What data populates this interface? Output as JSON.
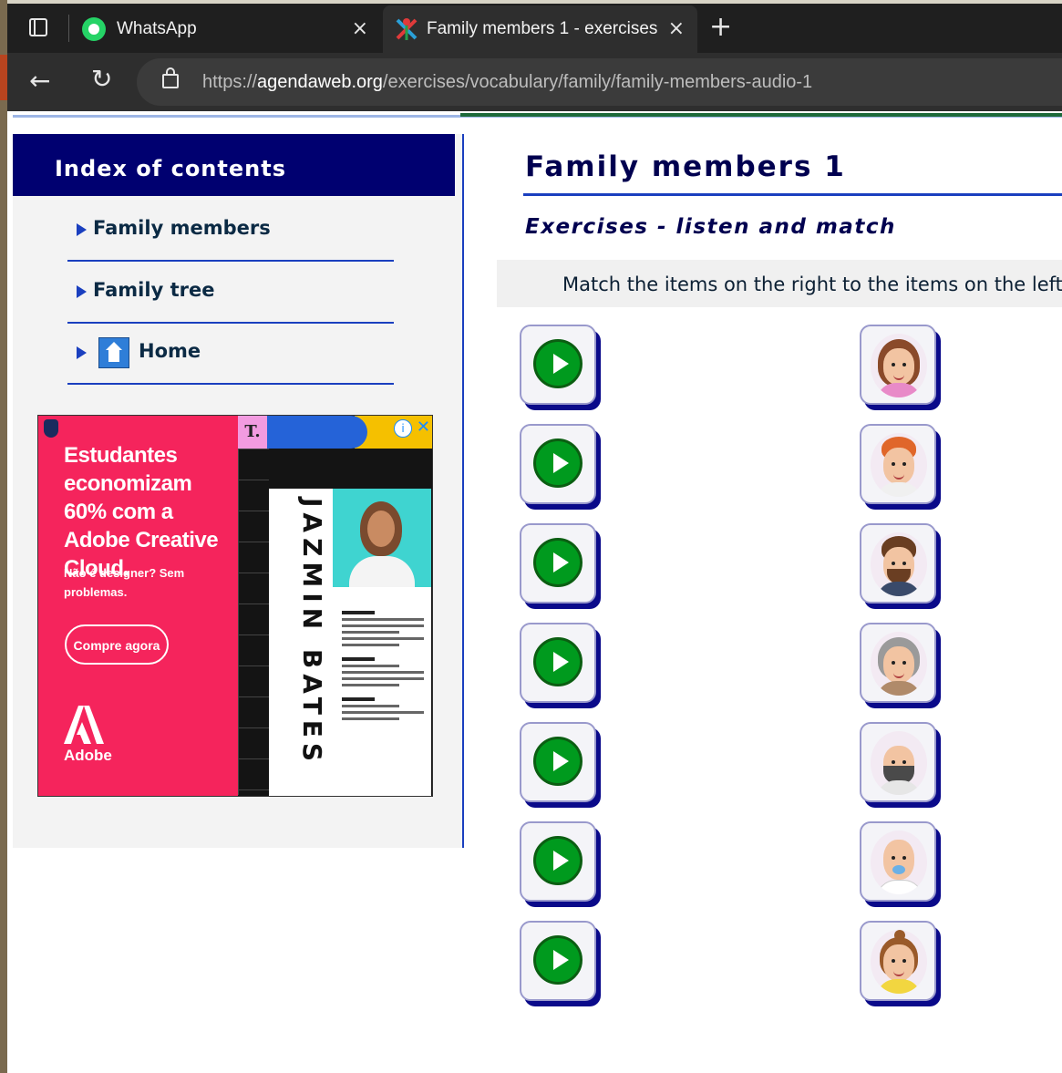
{
  "browser": {
    "tabs": [
      {
        "label": "WhatsApp",
        "icon": "whatsapp-icon"
      },
      {
        "label": "Family members 1 - exercises",
        "icon": "site-favicon-icon"
      }
    ],
    "close_glyph": "×",
    "url_prefix": "https://",
    "url_domain": "agendaweb.org",
    "url_path": "/exercises/vocabulary/family/family-members-audio-1"
  },
  "sidebar": {
    "heading": "Index of contents",
    "items": [
      {
        "label": "Family members"
      },
      {
        "label": "Family tree"
      },
      {
        "label": "Home"
      }
    ]
  },
  "ad": {
    "headline": "Estudantes economizam 60% com a Adobe Creative Cloud.",
    "subline": "Não é designer? Sem problemas.",
    "cta": "Compre agora",
    "brand": "Adobe",
    "t_badge": "T.",
    "resume_name": "JAZMIN BATES",
    "colors": {
      "background": "#f5245c",
      "panel": "#141414",
      "blue": "#2563d8",
      "yellow": "#f5c000"
    }
  },
  "main": {
    "title": "Family members 1",
    "subtitle": "Exercises - listen and match",
    "instructions": "Match the items on the right to the items on the left."
  },
  "exercise": {
    "audio_buttons": 7,
    "pictures": [
      "woman-avatar",
      "red-haired-man-avatar",
      "bearded-man-avatar",
      "grandmother-avatar",
      "grandfather-avatar",
      "baby-avatar",
      "girl-avatar"
    ]
  },
  "colors": {
    "heading_navy": "#000050",
    "sidebar_header": "#000070",
    "accent_blue": "#1a3fbf",
    "play_green": "#009a1e",
    "card_shadow": "#0a0a8a"
  }
}
